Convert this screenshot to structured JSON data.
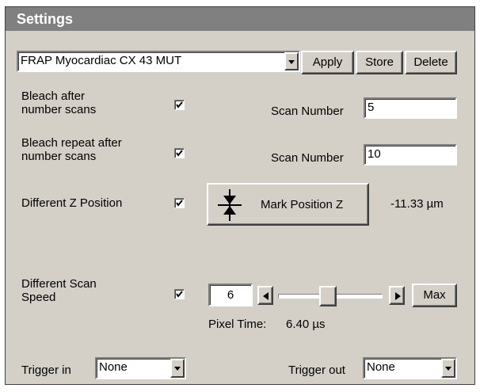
{
  "title": "Settings",
  "config": {
    "selected": "FRAP Myocardiac CX 43 MUT",
    "apply_label": "Apply",
    "store_label": "Store",
    "delete_label": "Delete"
  },
  "bleach_after": {
    "label_line1": "Bleach after",
    "label_line2": "number scans",
    "checked": true,
    "scan_label": "Scan Number",
    "scan_value": "5"
  },
  "bleach_repeat": {
    "label_line1": "Bleach repeat after",
    "label_line2": "number scans",
    "checked": true,
    "scan_label": "Scan Number",
    "scan_value": "10"
  },
  "z_position": {
    "label": "Different Z Position",
    "checked": true,
    "mark_label": "Mark Position Z",
    "value": "-11.33 µm"
  },
  "scan_speed": {
    "label_line1": "Different Scan",
    "label_line2": "Speed",
    "checked": true,
    "value": "6",
    "slider_level": 0.47,
    "max_label": "Max",
    "pixel_time_label": "Pixel Time:",
    "pixel_time_value": "6.40 µs"
  },
  "trigger_in": {
    "label": "Trigger in",
    "value": "None"
  },
  "trigger_out": {
    "label": "Trigger out",
    "value": "None"
  }
}
